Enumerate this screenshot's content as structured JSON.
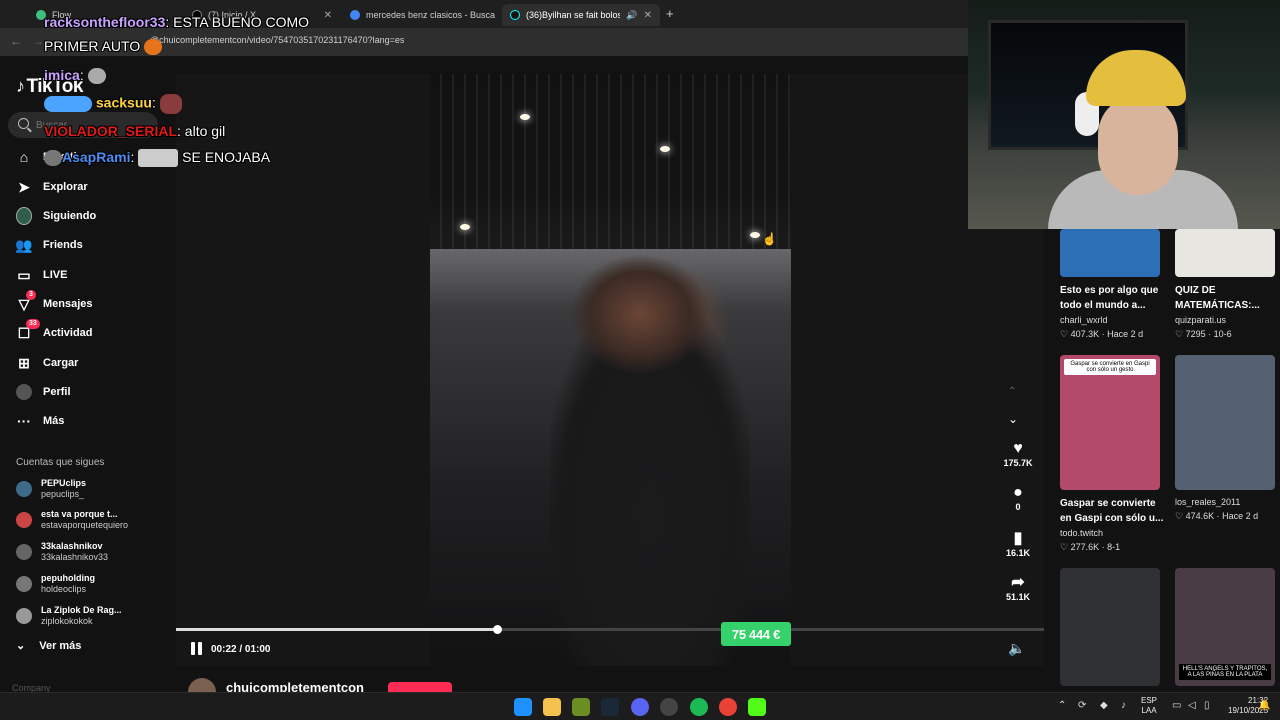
{
  "browser": {
    "tabs": [
      {
        "title": "Flow"
      },
      {
        "title": "(7) Inicio / X"
      },
      {
        "title": "mercedes benz clasicos - Busca"
      },
      {
        "title": "(36)Byilhan se fait boloss pa"
      }
    ],
    "url": "@chuicompletementcon/video/7547035170231176470?lang=es",
    "new_tab_label": "+"
  },
  "sidebar": {
    "logo": "TikTok",
    "search_placeholder": "Buscar",
    "nav": [
      {
        "label": "Para ti",
        "icon": "home-icon"
      },
      {
        "label": "Explorar",
        "icon": "compass-icon"
      },
      {
        "label": "Siguiendo",
        "icon": "following-icon"
      },
      {
        "label": "Friends",
        "icon": "friends-icon"
      },
      {
        "label": "LIVE",
        "icon": "live-icon"
      },
      {
        "label": "Mensajes",
        "icon": "message-icon",
        "badge": "3"
      },
      {
        "label": "Actividad",
        "icon": "activity-icon",
        "badge": "33"
      },
      {
        "label": "Cargar",
        "icon": "upload-icon"
      },
      {
        "label": "Perfil",
        "icon": "profile-icon"
      },
      {
        "label": "Más",
        "icon": "more-icon"
      }
    ],
    "following_title": "Cuentas que sigues",
    "following": [
      {
        "name": "PEPUclips",
        "user": "pepuclips_",
        "color": "#3e6b8a"
      },
      {
        "name": "esta va porque t...",
        "user": "estavaporquetequiero",
        "color": "#c44"
      },
      {
        "name": "33kalashnikov",
        "user": "33kalashnikov33",
        "color": "#666"
      },
      {
        "name": "pepuholding",
        "user": "holdeoclips",
        "color": "#777"
      },
      {
        "name": "La Ziplok De Rag...",
        "user": "ziplokokokok",
        "color": "#999"
      }
    ],
    "ver_mas": "Ver más",
    "company": "Company"
  },
  "video": {
    "current_time": "00:22 / 01:00",
    "progress": 0.37,
    "money_overlay": "75 444 €",
    "author": "chuicompletementcon"
  },
  "actions": {
    "likes": "175.7K",
    "comments": "0",
    "saves": "16.1K",
    "shares": "51.1K"
  },
  "related": [
    {
      "title": "Esto es por algo que todo el mundo a...",
      "user": "charli_wxrld",
      "stats": "407.3K · Hace 2 d",
      "color": "#2c6fb5"
    },
    {
      "title": "QUIZ DE MATEMÁTICAS:...",
      "user": "quizparati.us",
      "stats": "7295 · 10-6",
      "color": "#e8e6e0"
    },
    {
      "title": "Gaspar se convierte en Gaspi con sólo u...",
      "user": "todo.twitch",
      "stats": "277.6K · 8-1",
      "color": "#b44a6a",
      "thumb_caption": "Gaspar se convierte en Gaspi con sólo un gesto"
    },
    {
      "title": "",
      "user": "los_reales_2011",
      "stats": "474.6K · Hace 2 d",
      "color": "#556070"
    },
    {
      "title": "",
      "user": "",
      "stats": "",
      "color": "#2e3034",
      "thumb_caption": ""
    },
    {
      "title": "",
      "user": "",
      "stats": "",
      "color": "#4a3c44",
      "thumb_caption": "HELL'S ANGELS Y TRAPITOS, A LAS PIÑAS EN LA PLATA"
    }
  ],
  "chat": [
    {
      "user": "racksonthefloor33",
      "message": "ESTA BUENO COMO",
      "user_color": "#c9a2ff"
    },
    {
      "user": "",
      "message": "PRIMER AUTO",
      "user_color": "#ffffff"
    },
    {
      "user": "imica",
      "message": "",
      "user_color": "#c9a2ff"
    },
    {
      "user": "sacksuu",
      "message": "",
      "user_color": "#ffd23f"
    },
    {
      "user": "VIOLADOR_SERIAL",
      "message": "alto gil",
      "user_color": "#e01919"
    },
    {
      "user": "AsapRami",
      "message": "SE ENOJABA",
      "user_color": "#4d8df5"
    }
  ],
  "taskbar": {
    "lang": "ESP",
    "lang2": "LAA",
    "time": "21:32",
    "date": "19/10/2025"
  },
  "colors": {
    "accent": "#fe2c55",
    "money": "#35d16a"
  }
}
